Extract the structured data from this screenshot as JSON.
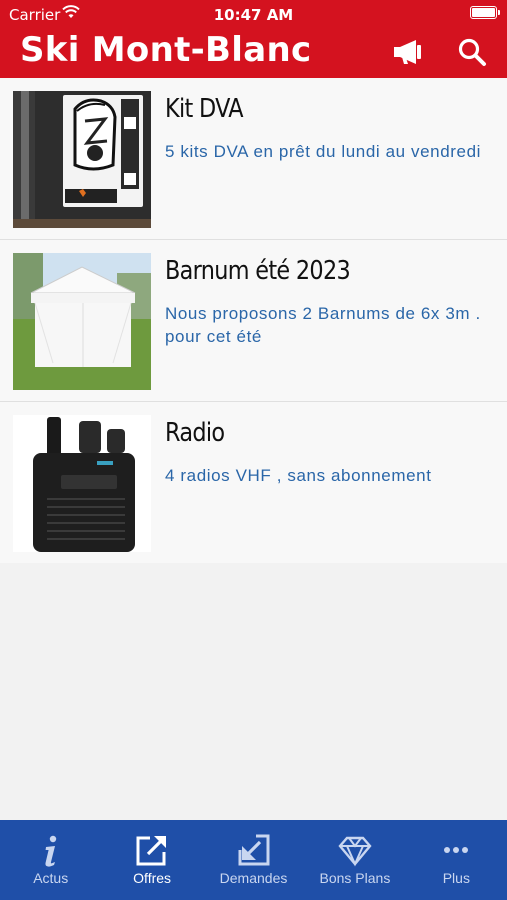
{
  "status_bar": {
    "carrier": "Carrier",
    "time": "10:47 AM"
  },
  "header": {
    "title": "Ski Mont-Blanc",
    "megaphone_icon": "megaphone-icon",
    "search_icon": "search-icon"
  },
  "colors": {
    "header_red": "#d4121f",
    "tabbar_blue": "#1f4fa8",
    "desc_blue": "#2a66a8"
  },
  "items": [
    {
      "title": "Kit DVA",
      "description": "5 kits DVA en prêt du lundi au vendredi"
    },
    {
      "title": "Barnum été 2023",
      "description": "Nous proposons 2 Barnums de 6x 3m . pour cet été"
    },
    {
      "title": "Radio",
      "description": "4 radios VHF , sans abonnement"
    }
  ],
  "tabs": [
    {
      "label": "Actus",
      "icon": "info-icon",
      "active": false
    },
    {
      "label": "Offres",
      "icon": "share-out-icon",
      "active": true
    },
    {
      "label": "Demandes",
      "icon": "share-in-icon",
      "active": false
    },
    {
      "label": "Bons Plans",
      "icon": "diamond-icon",
      "active": false
    },
    {
      "label": "Plus",
      "icon": "more-icon",
      "active": false
    }
  ]
}
